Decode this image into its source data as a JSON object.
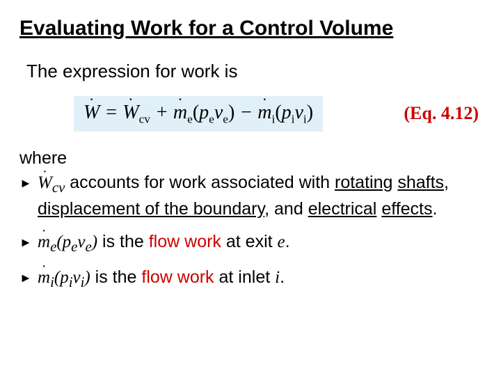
{
  "title": "Evaluating Work for a Control Volume",
  "intro": "The expression for work is",
  "equation": {
    "W_dot": "W",
    "eq": " = ",
    "Wcv_dot": "W",
    "Wcv_sub": "cv",
    "plus": " + ",
    "me_dot": "m",
    "me_sub": "e",
    "lpar1": "(",
    "pe": "p",
    "pe_sub": "e",
    "ve": "v",
    "ve_sub": "e",
    "rpar1": ")",
    "minus": " − ",
    "mi_dot": "m",
    "mi_sub": "i",
    "lpar2": "(",
    "pi": "p",
    "pi_sub": "i",
    "vi": "v",
    "vi_sub": "i",
    "rpar2": ")",
    "number": "(Eq. 4.12)"
  },
  "where_label": "where",
  "bullets": [
    {
      "pre_sym": {
        "var": "W",
        "sub": "cv"
      },
      "text_before": " accounts for work associated with ",
      "u1": "rotating",
      "mid1": " ",
      "u2": "shafts",
      "mid2": ", ",
      "u3": "displacement of the boundary",
      "mid3": ", and ",
      "u4": "electrical",
      "mid4": " ",
      "u5": "effects",
      "tail": "."
    },
    {
      "pre_sym": {
        "var": "m",
        "sub": "e"
      },
      "term": {
        "p": "p",
        "psub": "e",
        "v": "v",
        "vsub": "e"
      },
      "text_before": "  is the ",
      "red": "flow work",
      "mid": " at exit ",
      "ital": "e",
      "tail": "."
    },
    {
      "pre_sym": {
        "var": "m",
        "sub": "i"
      },
      "term": {
        "p": "p",
        "psub": "i",
        "v": "v",
        "vsub": "i"
      },
      "text_before": "  is the ",
      "red": "flow work",
      "mid": " at inlet ",
      "ital": "i",
      "tail": "."
    }
  ]
}
